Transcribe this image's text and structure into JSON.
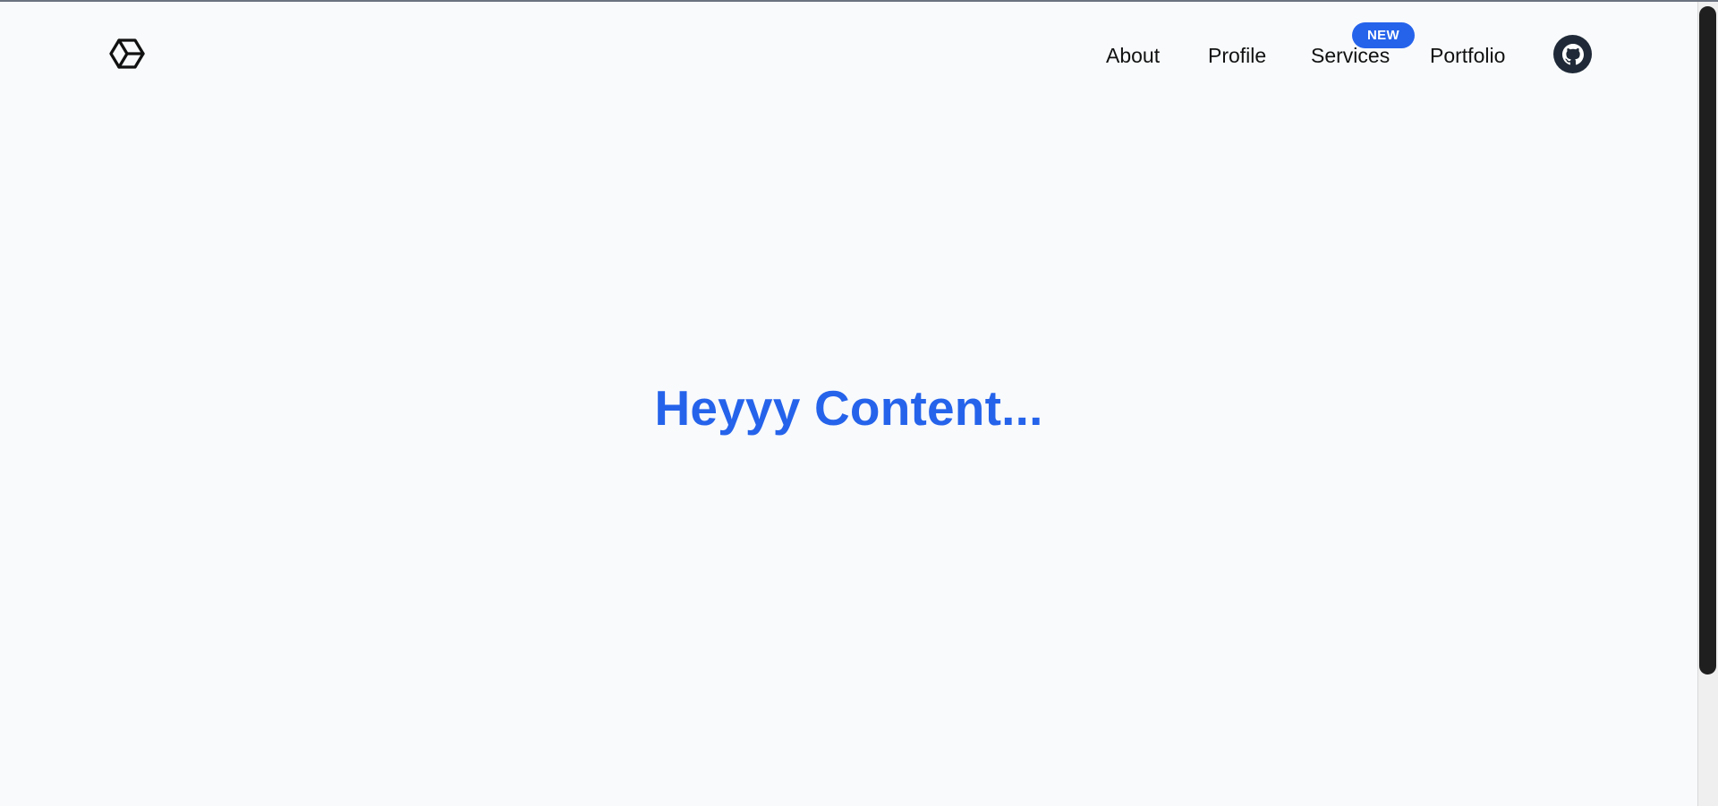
{
  "header": {
    "logo_icon": "hexagon-cube-icon",
    "nav": {
      "about_label": "About",
      "profile_label": "Profile",
      "services_label": "Services",
      "portfolio_label": "Portfolio",
      "services_badge": "NEW"
    },
    "github_icon": "github-icon"
  },
  "main": {
    "title": "Heyyy Content..."
  },
  "colors": {
    "accent": "#2563eb",
    "background": "#f8fafc",
    "text": "#111111",
    "github_button": "#1f2937"
  }
}
